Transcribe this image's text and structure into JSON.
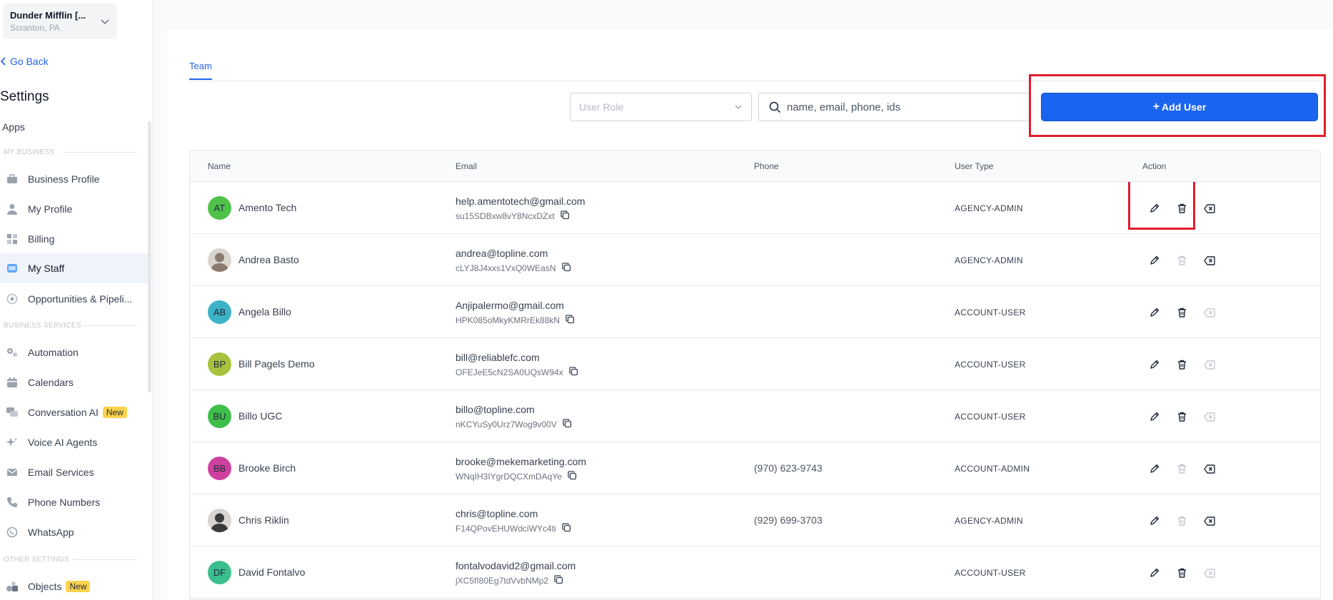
{
  "sidebar": {
    "location_name": "Dunder Mifflin [...",
    "location_sub": "Scranton, PA",
    "go_back": "Go Back",
    "settings_title": "Settings",
    "apps": "Apps",
    "sections": {
      "my_business": "MY BUSINESS",
      "business_services": "BUSINESS SERVICES",
      "other_settings": "OTHER SETTINGS"
    },
    "items": [
      {
        "label": "Business Profile",
        "icon": "briefcase-icon"
      },
      {
        "label": "My Profile",
        "icon": "user-icon"
      },
      {
        "label": "Billing",
        "icon": "grid-icon"
      },
      {
        "label": "My Staff",
        "icon": "staff-icon",
        "active": true
      },
      {
        "label": "Opportunities & Pipeli...",
        "icon": "target-icon"
      },
      {
        "label": "Automation",
        "icon": "gears-icon"
      },
      {
        "label": "Calendars",
        "icon": "calendar-icon"
      },
      {
        "label": "Conversation AI",
        "icon": "chat-icon",
        "badge": "New"
      },
      {
        "label": "Voice AI Agents",
        "icon": "sparkle-icon"
      },
      {
        "label": "Email Services",
        "icon": "mail-icon"
      },
      {
        "label": "Phone Numbers",
        "icon": "phone-icon"
      },
      {
        "label": "WhatsApp",
        "icon": "whatsapp-icon"
      },
      {
        "label": "Objects",
        "icon": "objects-icon",
        "badge": "New"
      }
    ]
  },
  "main": {
    "tab": "Team",
    "role_select_placeholder": "User Role",
    "search_placeholder": "name, email, phone, ids",
    "add_user_label": "Add User",
    "columns": [
      "Name",
      "Email",
      "Phone",
      "User Type",
      "Action"
    ],
    "rows": [
      {
        "initials": "AT",
        "avatar_color": "#4fc24a",
        "name": "Amento Tech",
        "email": "help.amentotech@gmail.com",
        "id": "su15SDBxw8vY8NcxDZxt",
        "phone": "",
        "type": "AGENCY-ADMIN",
        "delete_enabled": true,
        "x_enabled": true
      },
      {
        "initials": "",
        "avatar_color": "#8a7a6e",
        "photo": true,
        "name": "Andrea Basto",
        "email": "andrea@topline.com",
        "id": "cLYJ8J4xxs1VxQ0WEasN",
        "phone": "",
        "type": "AGENCY-ADMIN",
        "delete_enabled": false,
        "x_enabled": true
      },
      {
        "initials": "AB",
        "avatar_color": "#3cb3c7",
        "name": "Angela Billo",
        "email": "Anjipalermo@gmail.com",
        "id": "HPK085oMkyKMRrEk88kN",
        "phone": "",
        "type": "ACCOUNT-USER",
        "delete_enabled": true,
        "x_enabled": false
      },
      {
        "initials": "BP",
        "avatar_color": "#a9c23d",
        "name": "Bill Pagels Demo",
        "email": "bill@reliablefc.com",
        "id": "OFEJeE5cN2SA0UQsW94x",
        "phone": "",
        "type": "ACCOUNT-USER",
        "delete_enabled": true,
        "x_enabled": false
      },
      {
        "initials": "BU",
        "avatar_color": "#3fbf4a",
        "name": "Billo UGC",
        "email": "billo@topline.com",
        "id": "nKCYuSy0Urz7Wog9v00V",
        "phone": "",
        "type": "ACCOUNT-USER",
        "delete_enabled": true,
        "x_enabled": false
      },
      {
        "initials": "BB",
        "avatar_color": "#cf3f9f",
        "name": "Brooke Birch",
        "email": "brooke@mekemarketing.com",
        "id": "WNqIH3IYgrDQCXmDAqYe",
        "phone": "(970) 623-9743",
        "type": "ACCOUNT-ADMIN",
        "delete_enabled": false,
        "x_enabled": true
      },
      {
        "initials": "",
        "avatar_color": "#3a3a3a",
        "photo": true,
        "name": "Chris Riklin",
        "email": "chris@topline.com",
        "id": "F14QPovEHUWdciWYc4ti",
        "phone": "(929) 699-3703",
        "type": "AGENCY-ADMIN",
        "delete_enabled": false,
        "x_enabled": true
      },
      {
        "initials": "DF",
        "avatar_color": "#3cbf8f",
        "name": "David Fontalvo",
        "email": "fontalvodavid2@gmail.com",
        "id": "jXC5fI80Eg7tdVvbNMp2",
        "phone": "",
        "type": "ACCOUNT-USER",
        "delete_enabled": true,
        "x_enabled": false
      }
    ]
  },
  "colors": {
    "primary": "#1a64f0",
    "highlight": "#e11d2a",
    "badge": "#fcd34d"
  }
}
